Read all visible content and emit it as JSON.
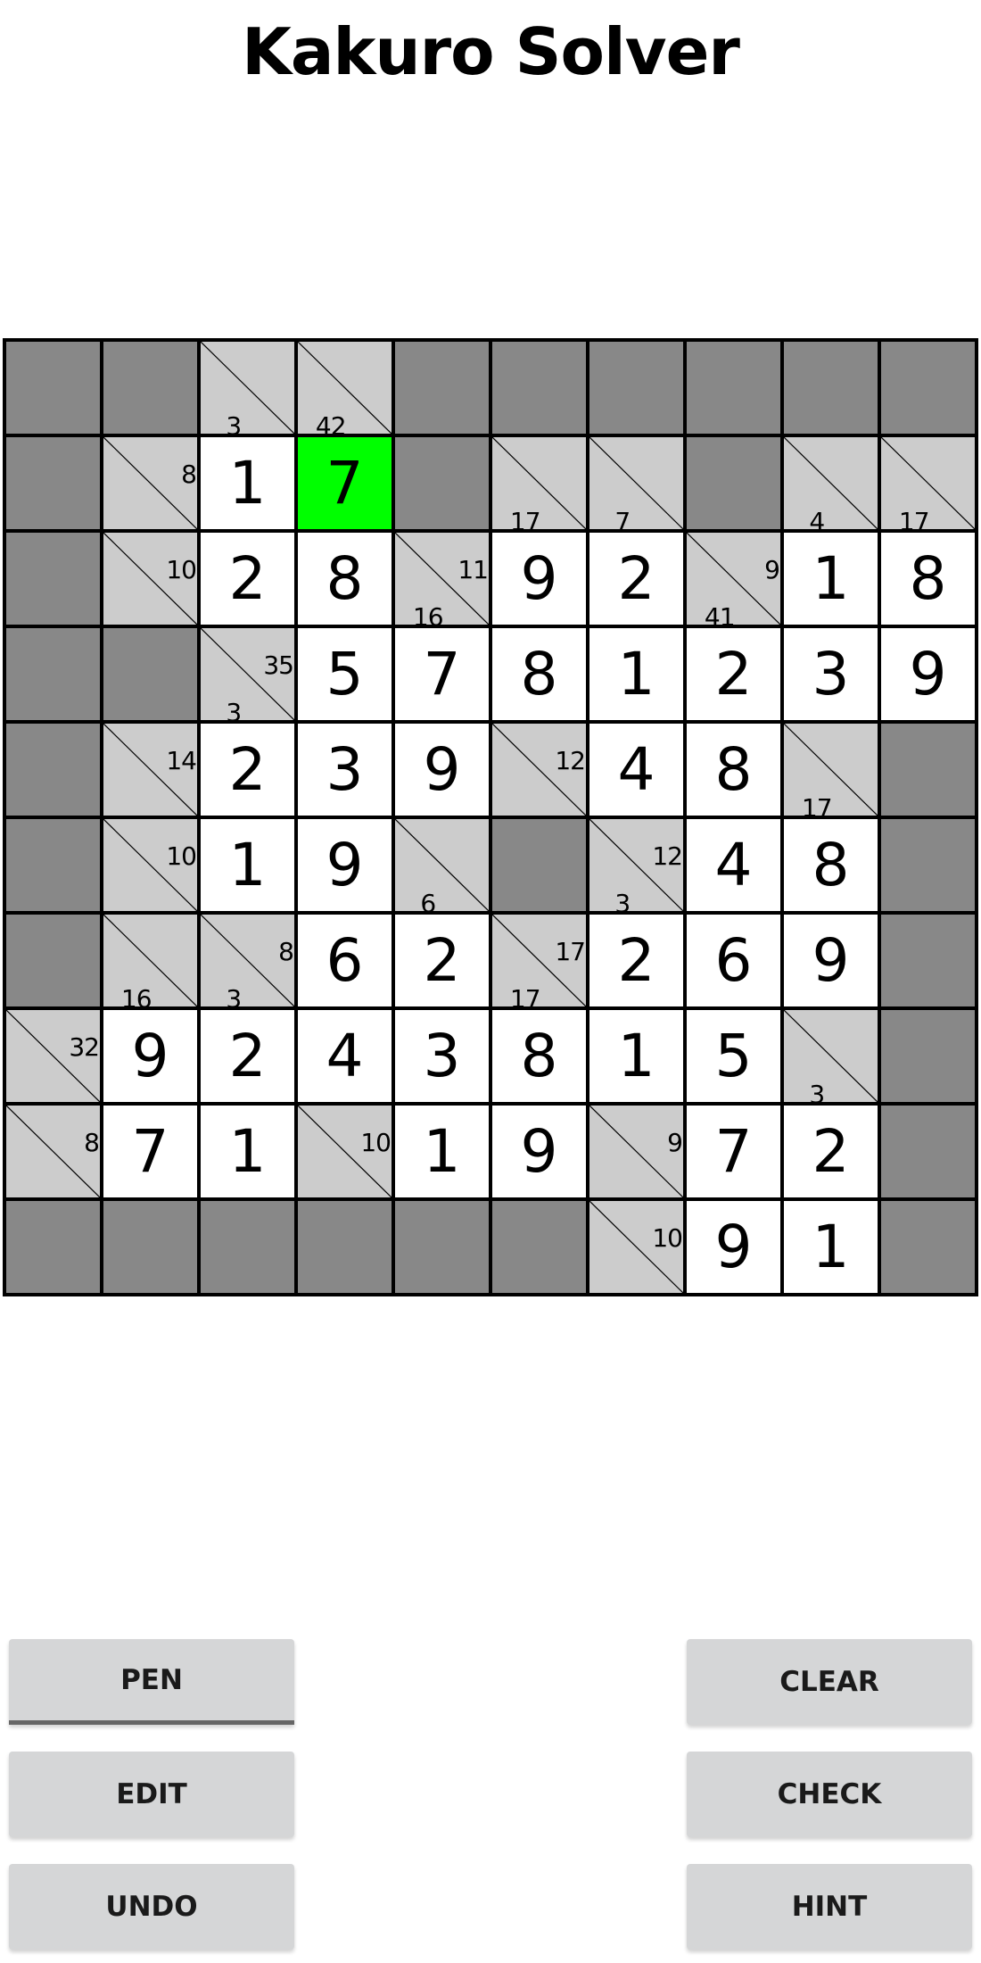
{
  "header": {
    "title": "Kakuro Solver"
  },
  "colors": {
    "blocked": "#888888",
    "clue": "#cccccc",
    "entry": "#ffffff",
    "selected": "#00ff00",
    "grid_line": "#000000",
    "button_bg": "#d5d6d7",
    "active_underline": "#666666"
  },
  "board": {
    "size": 10,
    "selected": [
      1,
      3
    ],
    "rows": [
      [
        {
          "t": "B"
        },
        {
          "t": "B"
        },
        {
          "t": "C",
          "d": "3"
        },
        {
          "t": "C",
          "d": "42"
        },
        {
          "t": "B"
        },
        {
          "t": "B"
        },
        {
          "t": "B"
        },
        {
          "t": "B"
        },
        {
          "t": "B"
        },
        {
          "t": "B"
        }
      ],
      [
        {
          "t": "B"
        },
        {
          "t": "C",
          "r": "8"
        },
        {
          "t": "E",
          "v": "1"
        },
        {
          "t": "E",
          "v": "7"
        },
        {
          "t": "B"
        },
        {
          "t": "C",
          "d": "17"
        },
        {
          "t": "C",
          "d": "7"
        },
        {
          "t": "B"
        },
        {
          "t": "C",
          "d": "4"
        },
        {
          "t": "C",
          "d": "17"
        }
      ],
      [
        {
          "t": "B"
        },
        {
          "t": "C",
          "r": "10"
        },
        {
          "t": "E",
          "v": "2"
        },
        {
          "t": "E",
          "v": "8"
        },
        {
          "t": "C",
          "r": "11",
          "d": "16"
        },
        {
          "t": "E",
          "v": "9"
        },
        {
          "t": "E",
          "v": "2"
        },
        {
          "t": "C",
          "r": "9",
          "d": "41"
        },
        {
          "t": "E",
          "v": "1"
        },
        {
          "t": "E",
          "v": "8"
        }
      ],
      [
        {
          "t": "B"
        },
        {
          "t": "B"
        },
        {
          "t": "C",
          "r": "35",
          "d": "3"
        },
        {
          "t": "E",
          "v": "5"
        },
        {
          "t": "E",
          "v": "7"
        },
        {
          "t": "E",
          "v": "8"
        },
        {
          "t": "E",
          "v": "1"
        },
        {
          "t": "E",
          "v": "2"
        },
        {
          "t": "E",
          "v": "3"
        },
        {
          "t": "E",
          "v": "9"
        }
      ],
      [
        {
          "t": "B"
        },
        {
          "t": "C",
          "r": "14"
        },
        {
          "t": "E",
          "v": "2"
        },
        {
          "t": "E",
          "v": "3"
        },
        {
          "t": "E",
          "v": "9"
        },
        {
          "t": "C",
          "r": "12"
        },
        {
          "t": "E",
          "v": "4"
        },
        {
          "t": "E",
          "v": "8"
        },
        {
          "t": "C",
          "d": "17"
        },
        {
          "t": "B"
        }
      ],
      [
        {
          "t": "B"
        },
        {
          "t": "C",
          "r": "10"
        },
        {
          "t": "E",
          "v": "1"
        },
        {
          "t": "E",
          "v": "9"
        },
        {
          "t": "C",
          "d": "6"
        },
        {
          "t": "B"
        },
        {
          "t": "C",
          "r": "12",
          "d": "3"
        },
        {
          "t": "E",
          "v": "4"
        },
        {
          "t": "E",
          "v": "8"
        },
        {
          "t": "B"
        }
      ],
      [
        {
          "t": "B"
        },
        {
          "t": "C",
          "d": "16"
        },
        {
          "t": "C",
          "r": "8",
          "d": "3"
        },
        {
          "t": "E",
          "v": "6"
        },
        {
          "t": "E",
          "v": "2"
        },
        {
          "t": "C",
          "r": "17",
          "d": "17"
        },
        {
          "t": "E",
          "v": "2"
        },
        {
          "t": "E",
          "v": "6"
        },
        {
          "t": "E",
          "v": "9"
        },
        {
          "t": "B"
        }
      ],
      [
        {
          "t": "C",
          "r": "32"
        },
        {
          "t": "E",
          "v": "9"
        },
        {
          "t": "E",
          "v": "2"
        },
        {
          "t": "E",
          "v": "4"
        },
        {
          "t": "E",
          "v": "3"
        },
        {
          "t": "E",
          "v": "8"
        },
        {
          "t": "E",
          "v": "1"
        },
        {
          "t": "E",
          "v": "5"
        },
        {
          "t": "C",
          "d": "3"
        },
        {
          "t": "B"
        }
      ],
      [
        {
          "t": "C",
          "r": "8"
        },
        {
          "t": "E",
          "v": "7"
        },
        {
          "t": "E",
          "v": "1"
        },
        {
          "t": "C",
          "r": "10"
        },
        {
          "t": "E",
          "v": "1"
        },
        {
          "t": "E",
          "v": "9"
        },
        {
          "t": "C",
          "r": "9"
        },
        {
          "t": "E",
          "v": "7"
        },
        {
          "t": "E",
          "v": "2"
        },
        {
          "t": "B"
        }
      ],
      [
        {
          "t": "B"
        },
        {
          "t": "B"
        },
        {
          "t": "B"
        },
        {
          "t": "B"
        },
        {
          "t": "B"
        },
        {
          "t": "B"
        },
        {
          "t": "C",
          "r": "10"
        },
        {
          "t": "E",
          "v": "9"
        },
        {
          "t": "E",
          "v": "1"
        },
        {
          "t": "B"
        }
      ]
    ]
  },
  "controls": {
    "pen": {
      "label": "PEN",
      "active": true
    },
    "edit": {
      "label": "EDIT"
    },
    "undo": {
      "label": "UNDO"
    },
    "clear": {
      "label": "CLEAR"
    },
    "check": {
      "label": "CHECK"
    },
    "hint": {
      "label": "HINT"
    }
  }
}
